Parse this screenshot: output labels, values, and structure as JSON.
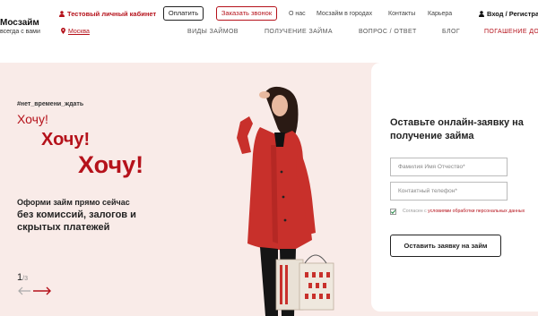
{
  "header": {
    "logo_title": "Мосзайм",
    "logo_subtitle": "всегда с вами",
    "cabinet_label": "Тестовый личный кабинет",
    "city": "Москва",
    "pay_button": "Оплатить",
    "call_button": "Заказать звонок",
    "top_links": [
      "О нас",
      "Мосзайм в городах",
      "Контакты",
      "Карьера"
    ],
    "login_label": "Вход / Регистра",
    "main_nav": [
      "ВИДЫ ЗАЙМОВ",
      "ПОЛУЧЕНИЕ ЗАЙМА",
      "ВОПРОС / ОТВЕТ",
      "БЛОГ",
      "ПОГАШЕНИЕ ДО"
    ]
  },
  "hero": {
    "hashtag": "#нет_времени_ждать",
    "want_small": "Хочу!",
    "want_medium": "Хочу!",
    "want_large": "Хочу!",
    "offer_line": "Оформи займ прямо сейчас",
    "offer_bold": "без комиссий, залогов и скрытых платежей",
    "slide_current": "1",
    "slide_total": "/3"
  },
  "form": {
    "title": "Оставьте онлайн-заявку на получение займа",
    "name_placeholder": "Фамилия Имя Отчество*",
    "phone_placeholder": "Контактный телефон*",
    "consent_prefix": "Согласен с ",
    "consent_link": "условиями обработки персональных данных",
    "consent_checked": true,
    "submit_label": "Оставить заявку на займ"
  },
  "colors": {
    "accent": "#b5121b",
    "hero_bg": "#f9ebe8",
    "coat": "#c8302b"
  },
  "icons": [
    "user-icon",
    "map-pin-icon",
    "arrow-left-icon",
    "arrow-right-icon",
    "check-icon"
  ]
}
